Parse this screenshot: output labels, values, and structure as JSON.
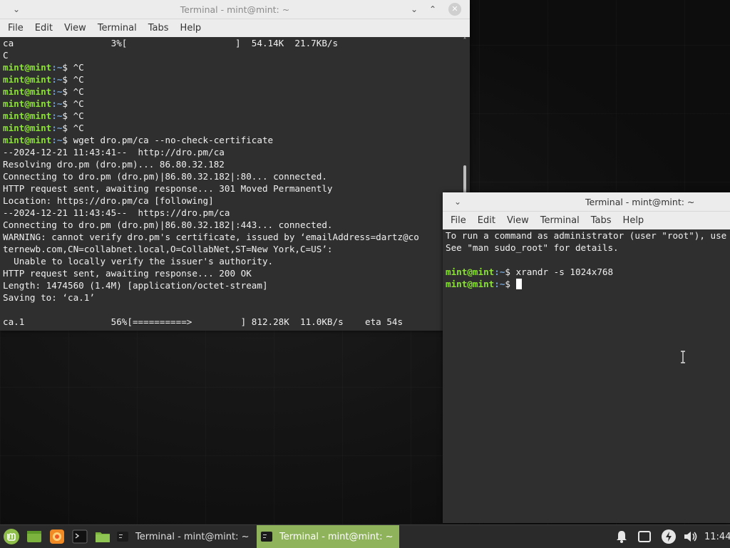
{
  "window1": {
    "title": "Terminal - mint@mint: ~",
    "menu": [
      "File",
      "Edit",
      "View",
      "Terminal",
      "Tabs",
      "Help"
    ],
    "lines": [
      {
        "text": "ca                  3%[                    ]  54.14K  21.7KB/s"
      },
      {
        "text": "C"
      },
      {
        "prompt": true,
        "user": "mint@mint",
        "path": ":~",
        "text": "$ ^C"
      },
      {
        "prompt": true,
        "user": "mint@mint",
        "path": ":~",
        "text": "$ ^C"
      },
      {
        "prompt": true,
        "user": "mint@mint",
        "path": ":~",
        "text": "$ ^C"
      },
      {
        "prompt": true,
        "user": "mint@mint",
        "path": ":~",
        "text": "$ ^C"
      },
      {
        "prompt": true,
        "user": "mint@mint",
        "path": ":~",
        "text": "$ ^C"
      },
      {
        "prompt": true,
        "user": "mint@mint",
        "path": ":~",
        "text": "$ ^C"
      },
      {
        "prompt": true,
        "user": "mint@mint",
        "path": ":~",
        "text": "$ wget dro.pm/ca --no-check-certificate"
      },
      {
        "text": "--2024-12-21 11:43:41--  http://dro.pm/ca"
      },
      {
        "text": "Resolving dro.pm (dro.pm)... 86.80.32.182"
      },
      {
        "text": "Connecting to dro.pm (dro.pm)|86.80.32.182|:80... connected."
      },
      {
        "text": "HTTP request sent, awaiting response... 301 Moved Permanently"
      },
      {
        "text": "Location: https://dro.pm/ca [following]"
      },
      {
        "text": "--2024-12-21 11:43:45--  https://dro.pm/ca"
      },
      {
        "text": "Connecting to dro.pm (dro.pm)|86.80.32.182|:443... connected."
      },
      {
        "text": "WARNING: cannot verify dro.pm's certificate, issued by ‘emailAddress=dartz@co"
      },
      {
        "text": "ternewb.com,CN=collabnet.local,O=CollabNet,ST=New York,C=US’:"
      },
      {
        "text": "  Unable to locally verify the issuer's authority."
      },
      {
        "text": "HTTP request sent, awaiting response... 200 OK"
      },
      {
        "text": "Length: 1474560 (1.4M) [application/octet-stream]"
      },
      {
        "text": "Saving to: ‘ca.1’"
      },
      {
        "text": ""
      },
      {
        "text": "ca.1                56%[==========>         ] 812.28K  11.0KB/s    eta 54s"
      }
    ]
  },
  "window2": {
    "title": "Terminal - mint@mint: ~",
    "menu": [
      "File",
      "Edit",
      "View",
      "Terminal",
      "Tabs",
      "Help"
    ],
    "lines": [
      {
        "text": "To run a command as administrator (user \"root\"), use \"sudo <command>\"."
      },
      {
        "text": "See \"man sudo_root\" for details."
      },
      {
        "text": ""
      },
      {
        "prompt": true,
        "user": "mint@mint",
        "path": ":~",
        "text": "$ xrandr -s 1024x768"
      },
      {
        "prompt": true,
        "user": "mint@mint",
        "path": ":~",
        "text": "$ ",
        "cursor": true
      }
    ]
  },
  "taskbar": {
    "tasks": [
      {
        "label": "Terminal - mint@mint: ~",
        "active": false
      },
      {
        "label": "Terminal - mint@mint: ~",
        "active": true
      }
    ],
    "clock": "11:44"
  },
  "colors": {
    "prompt_user": "#8ae234",
    "prompt_path": "#729fcf",
    "active_task": "#8fb35a",
    "mint_green": "#8fbf4a"
  },
  "icons": [
    "mint-menu-icon",
    "show-desktop-icon",
    "firefox-icon",
    "terminal-icon",
    "files-icon",
    "notifications-bell-icon",
    "window-list-icon",
    "power-icon",
    "volume-icon"
  ]
}
